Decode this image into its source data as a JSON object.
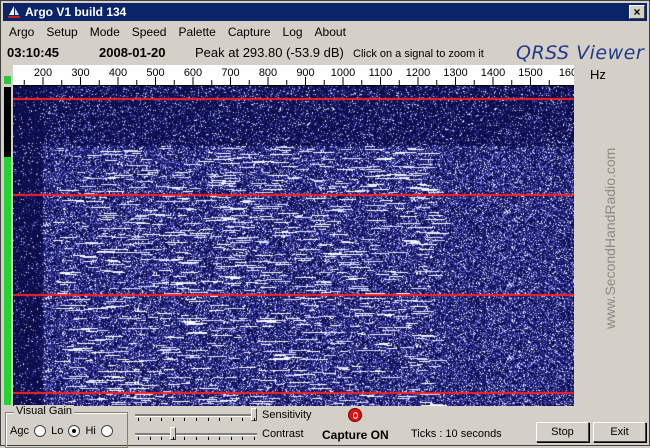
{
  "window": {
    "title": "Argo V1 build 134",
    "close_glyph": "×"
  },
  "menu": [
    "Argo",
    "Setup",
    "Mode",
    "Speed",
    "Palette",
    "Capture",
    "Log",
    "About"
  ],
  "info": {
    "time": "03:10:45",
    "date": "2008-01-20",
    "peak": "Peak at 293.80 (-53.9 dB)",
    "hint": "Click on a signal to zoom it",
    "brand": "QRSS Viewer"
  },
  "ruler": {
    "labels": [
      "200",
      "300",
      "400",
      "500",
      "600",
      "700",
      "800",
      "900",
      "1000",
      "1100",
      "1200",
      "1300",
      "1400",
      "1500",
      "160"
    ],
    "unit": "Hz"
  },
  "watermark": "www.SecondHandRadio.com",
  "controls": {
    "visual_gain_label": "Visual Gain",
    "agc_label": "Agc",
    "lo_label": "Lo",
    "hi_label": "Hi",
    "selected_gain": "Lo",
    "sensitivity_label": "Sensitivity",
    "contrast_label": "Contrast",
    "sensitivity_value": 1.0,
    "contrast_value": 0.3,
    "capture_label": "Capture ON",
    "ticks_label": "Ticks  : 10 seconds",
    "stop_label": "Stop",
    "exit_label": "Exit"
  },
  "level_meter": 0.78,
  "colors": {
    "spectrogram_bg": "#0c0d4a",
    "marker_line": "#ff2020",
    "title_bar": "#0a246a",
    "level": "#21d42f"
  }
}
